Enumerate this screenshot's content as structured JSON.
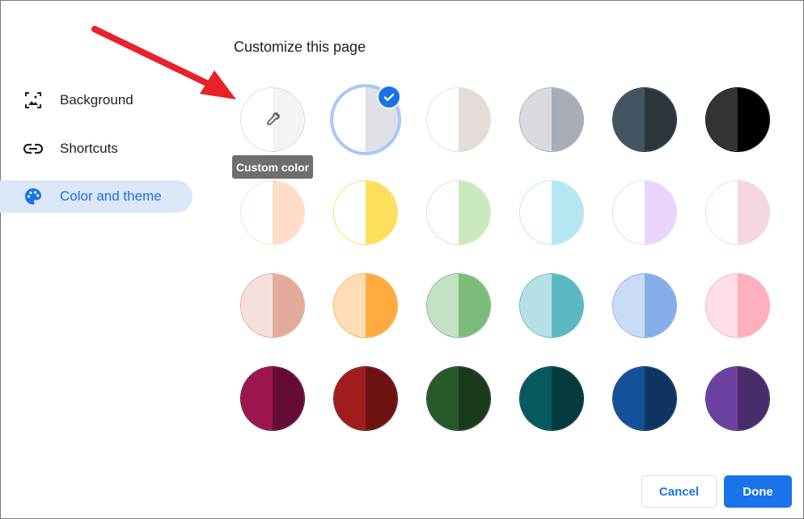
{
  "page": {
    "title": "Customize this page"
  },
  "sidebar": {
    "items": [
      {
        "label": "Background",
        "icon": "image-icon",
        "active": false
      },
      {
        "label": "Shortcuts",
        "icon": "link-icon",
        "active": false
      },
      {
        "label": "Color and theme",
        "icon": "palette-icon",
        "active": true
      }
    ]
  },
  "custom_color": {
    "tooltip": "Custom color",
    "icon": "eyedropper-icon"
  },
  "colors": {
    "accent": "#1a73e8",
    "selected_ring": "#a8c7fa",
    "annotation_arrow": "#e8212a"
  },
  "swatches": [
    [
      {
        "name": "custom",
        "left": "#ffffff",
        "right": "#f1f3f4",
        "border": "#dadce0",
        "custom": true
      },
      {
        "name": "default",
        "left": "#ffffff",
        "right": "#dee1e6",
        "border": "#dadce0",
        "selected": true
      },
      {
        "name": "warm-grey",
        "left": "#ffffff",
        "right": "#e3dcd8",
        "border": "#e3dcd8"
      },
      {
        "name": "cool-grey",
        "left": "#d9dbe0",
        "right": "#a8acb7",
        "border": "#a8acb7"
      },
      {
        "name": "slate",
        "left": "#435460",
        "right": "#2c363d",
        "border": "#2c363d"
      },
      {
        "name": "black",
        "left": "#333333",
        "right": "#000000",
        "border": "#000000"
      }
    ],
    [
      {
        "name": "peach-light",
        "left": "#ffffff",
        "right": "#fddcca",
        "border": "#fddcca"
      },
      {
        "name": "yellow-light",
        "left": "#ffffff",
        "right": "#fddf5e",
        "border": "#fddf5e"
      },
      {
        "name": "green-light",
        "left": "#ffffff",
        "right": "#cbe9c1",
        "border": "#cbe9c1"
      },
      {
        "name": "aqua-light",
        "left": "#ffffff",
        "right": "#b6e6f1",
        "border": "#b6e6f1"
      },
      {
        "name": "lavender-light",
        "left": "#ffffff",
        "right": "#e8d4fd",
        "border": "#e8d4fd"
      },
      {
        "name": "pink-light",
        "left": "#ffffff",
        "right": "#f5d6e3",
        "border": "#f5d6e3"
      }
    ],
    [
      {
        "name": "rose-beige",
        "left": "#f4e0db",
        "right": "#e3ab9b",
        "border": "#e3ab9b"
      },
      {
        "name": "orange",
        "left": "#ffdeb7",
        "right": "#ffab40",
        "border": "#ffab40"
      },
      {
        "name": "green",
        "left": "#c4e1c6",
        "right": "#7bbb7c",
        "border": "#7bbb7c"
      },
      {
        "name": "teal",
        "left": "#b7e0e4",
        "right": "#5cb8c0",
        "border": "#5cb8c0"
      },
      {
        "name": "blue",
        "left": "#cadbf6",
        "right": "#87ade8",
        "border": "#87ade8"
      },
      {
        "name": "pink",
        "left": "#fddfe5",
        "right": "#feafbd",
        "border": "#feafbd"
      }
    ],
    [
      {
        "name": "magenta-dark",
        "left": "#9d1650",
        "right": "#640c33",
        "border": "#640c33"
      },
      {
        "name": "red-dark",
        "left": "#a11c1f",
        "right": "#6d1213",
        "border": "#6d1213"
      },
      {
        "name": "green-dark",
        "left": "#28592b",
        "right": "#1b3a1c",
        "border": "#1b3a1c"
      },
      {
        "name": "teal-dark",
        "left": "#05595f",
        "right": "#033a3e",
        "border": "#033a3e"
      },
      {
        "name": "blue-dark",
        "left": "#15519a",
        "right": "#0f3462",
        "border": "#0f3462"
      },
      {
        "name": "purple-dark",
        "left": "#6c40a0",
        "right": "#472b6a",
        "border": "#472b6a"
      }
    ]
  ],
  "footer": {
    "cancel_label": "Cancel",
    "done_label": "Done"
  }
}
